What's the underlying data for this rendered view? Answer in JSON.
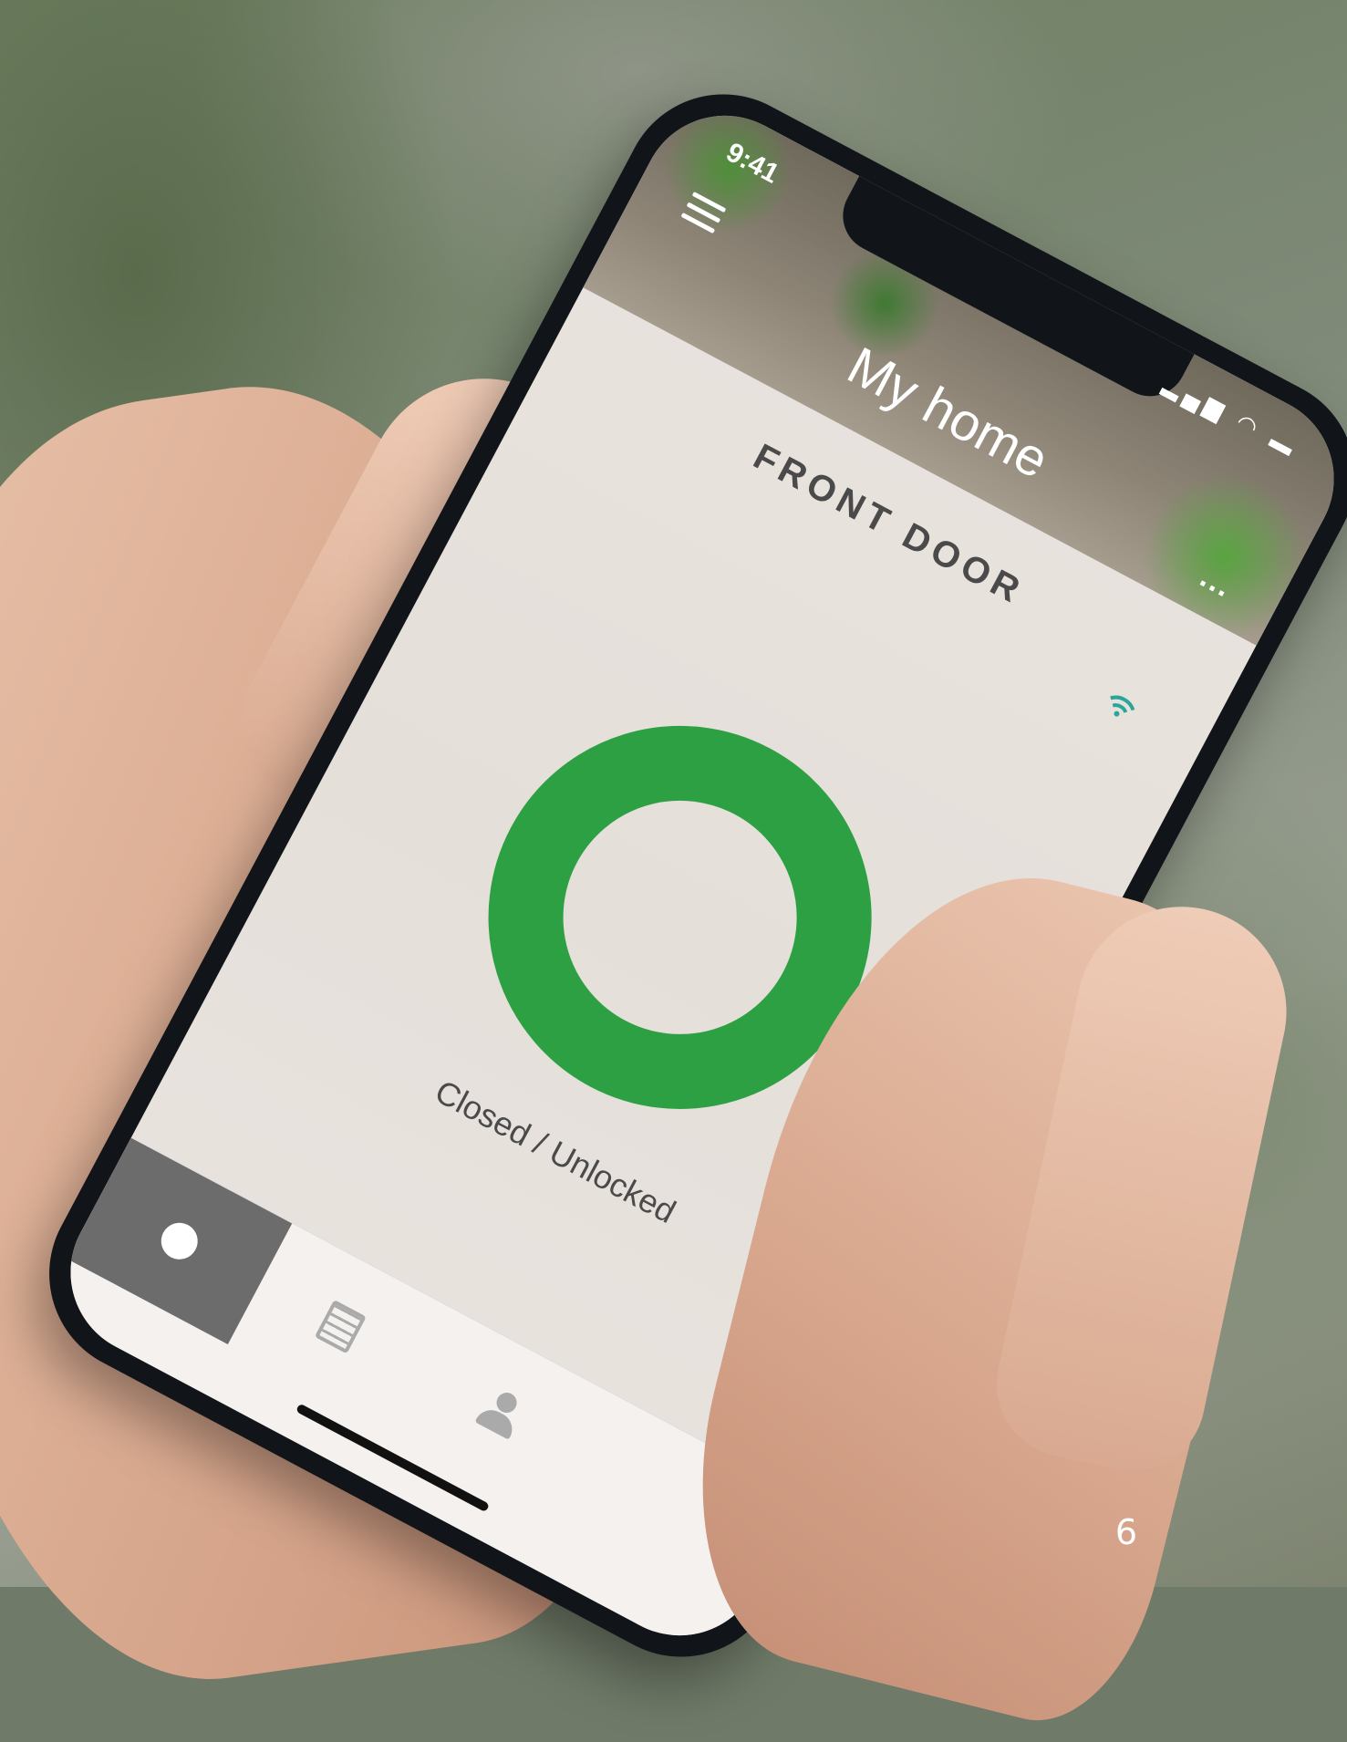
{
  "status_bar": {
    "time": "9:41"
  },
  "app": {
    "home_title": "My home",
    "door_name": "FRONT DOOR",
    "lock_status": "Closed / Unlocked",
    "more_label": "..."
  },
  "colors": {
    "lock_ring": "#2ea044",
    "connection_icon": "#2aa59a"
  },
  "tabs": [
    {
      "icon": "lock-dot-icon",
      "active": true
    },
    {
      "icon": "log-icon",
      "active": false
    },
    {
      "icon": "users-icon",
      "active": false
    }
  ],
  "page_number": "6"
}
